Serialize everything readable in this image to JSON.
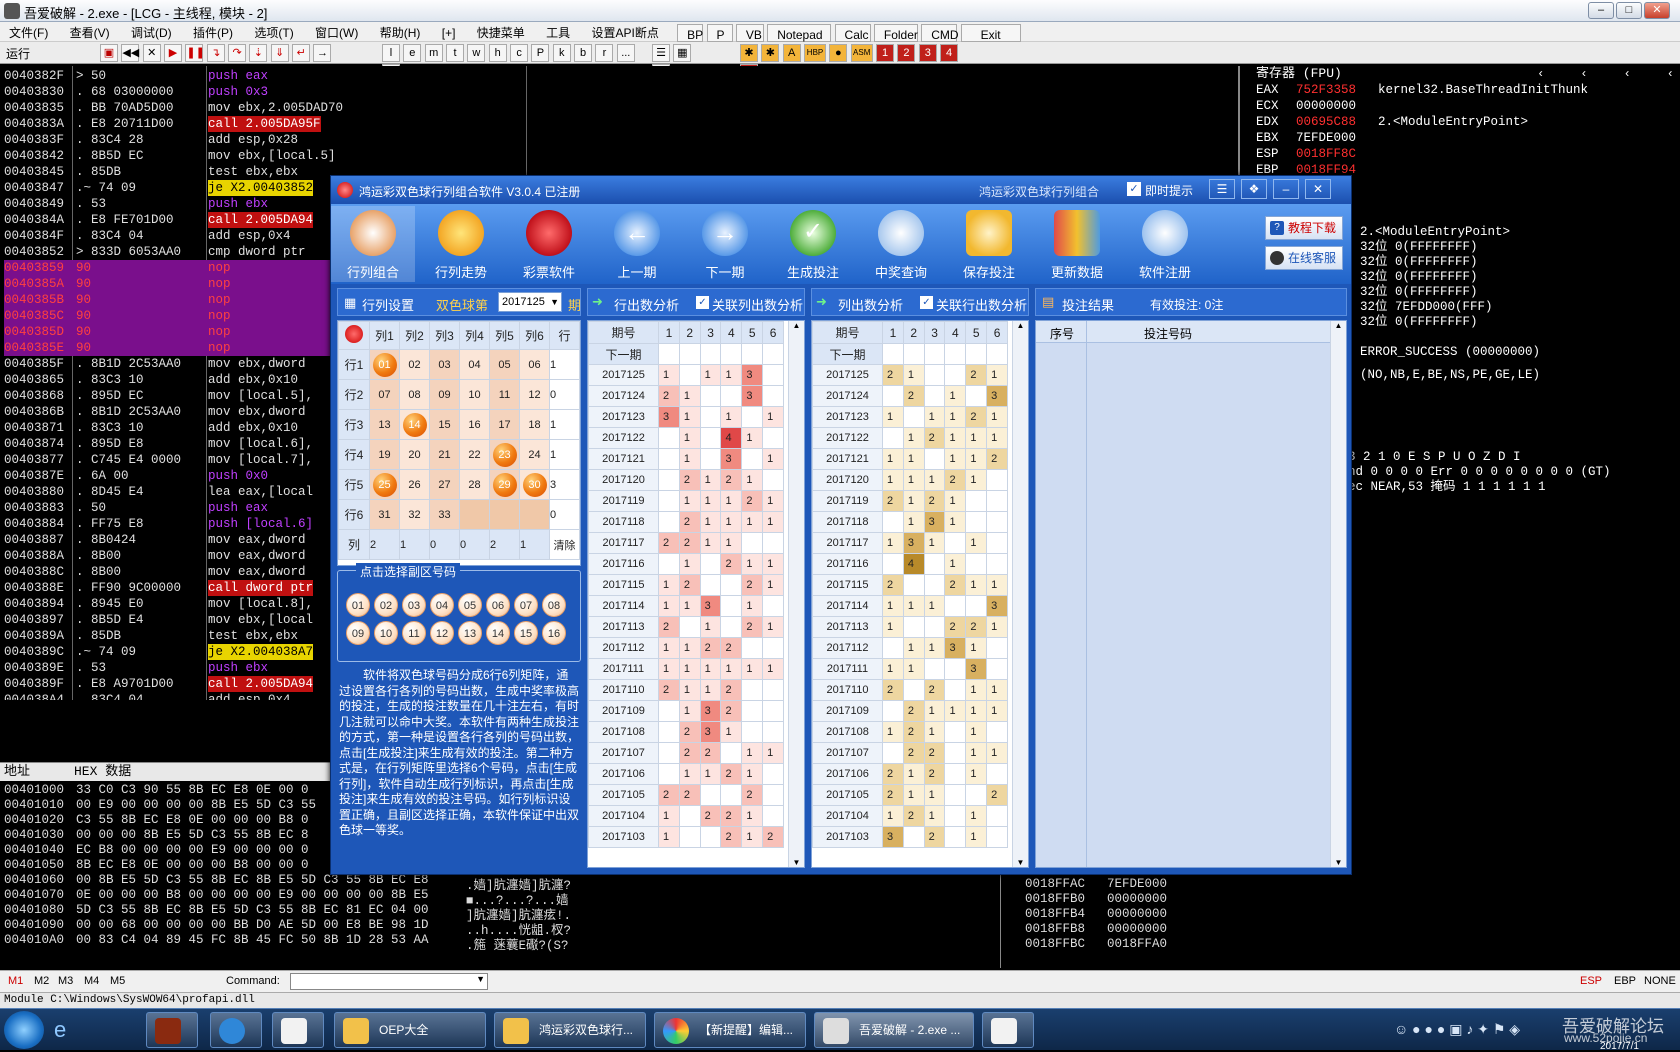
{
  "window": {
    "title": "吾爱破解 - 2.exe - [LCG - 主线程, 模块 - 2]",
    "status_run": "运行"
  },
  "menu": [
    "文件(F)",
    "查看(V)",
    "调试(D)",
    "插件(P)",
    "选项(T)",
    "窗口(W)",
    "帮助(H)",
    "[+]",
    "快捷菜单",
    "工具",
    "设置API断点"
  ],
  "quick_buttons": [
    "BP",
    "P",
    "VB",
    "Notepad",
    "Calc",
    "Folder",
    "CMD",
    "Exit"
  ],
  "toolbar_letters": [
    "l",
    "e",
    "m",
    "t",
    "w",
    "h",
    "c",
    "P",
    "k",
    "b",
    "r",
    "...",
    "s"
  ],
  "toolbar_nums": [
    "1",
    "2",
    "3",
    "4",
    "5"
  ],
  "disasm": [
    [
      "0040382F",
      ">  50",
      "push eax"
    ],
    [
      "00403830",
      ".  68 03000000",
      "push 0x3"
    ],
    [
      "00403835",
      ".  BB 70AD5D00",
      "mov ebx,2.005DAD70"
    ],
    [
      "0040383A",
      ".  E8 20711D00",
      "call 2.005DA95F"
    ],
    [
      "0040383F",
      ".  83C4 28",
      "add esp,0x28"
    ],
    [
      "00403842",
      ".  8B5D EC",
      "mov ebx,[local.5]"
    ],
    [
      "00403845",
      ".  85DB",
      "test ebx,ebx"
    ],
    [
      "00403847",
      ".~ 74 09",
      "je X2.00403852"
    ],
    [
      "00403849",
      ".  53",
      "push ebx"
    ],
    [
      "0040384A",
      ".  E8 FE701D00",
      "call 2.005DA94"
    ],
    [
      "0040384F",
      ".  83C4 04",
      "add esp,0x4"
    ],
    [
      "00403852",
      ">  833D 6053AA0",
      "cmp dword ptr"
    ],
    [
      "00403859",
      "   90",
      "nop"
    ],
    [
      "0040385A",
      "   90",
      "nop"
    ],
    [
      "0040385B",
      "   90",
      "nop"
    ],
    [
      "0040385C",
      "   90",
      "nop"
    ],
    [
      "0040385D",
      "   90",
      "nop"
    ],
    [
      "0040385E",
      "   90",
      "nop"
    ],
    [
      "0040385F",
      ".  8B1D 2C53AA0",
      "mov ebx,dword"
    ],
    [
      "00403865",
      ".  83C3 10",
      "add ebx,0x10"
    ],
    [
      "00403868",
      ".  895D EC",
      "mov [local.5],"
    ],
    [
      "0040386B",
      ".  8B1D 2C53AA0",
      "mov ebx,dword"
    ],
    [
      "00403871",
      ".  83C3 10",
      "add ebx,0x10"
    ],
    [
      "00403874",
      ".  895D E8",
      "mov [local.6],"
    ],
    [
      "00403877",
      ".  C745 E4 0000",
      "mov [local.7],"
    ],
    [
      "0040387E",
      ".  6A 00",
      "push 0x0"
    ],
    [
      "00403880",
      ".  8D45 E4",
      "lea eax,[local"
    ],
    [
      "00403883",
      ".  50",
      "push eax"
    ],
    [
      "00403884",
      ".  FF75 E8",
      "push [local.6]"
    ],
    [
      "00403887",
      ".  8B0424",
      "mov eax,dword"
    ],
    [
      "0040388A",
      ".  8B00",
      "mov eax,dword"
    ],
    [
      "0040388C",
      ".  8B00",
      "mov eax,dword"
    ],
    [
      "0040388E",
      ".  FF90 9C00000",
      "call dword ptr"
    ],
    [
      "00403894",
      ".  8945 E0",
      "mov [local.8],"
    ],
    [
      "00403897",
      ".  8B5D E4",
      "mov ebx,[local"
    ],
    [
      "0040389A",
      ".  85DB",
      "test ebx,ebx"
    ],
    [
      "0040389C",
      ".~ 74 09",
      "je X2.004038A7"
    ],
    [
      "0040389E",
      ".  53",
      "push ebx"
    ],
    [
      "0040389F",
      ".  E8 A9701D00",
      "call 2.005DA94"
    ],
    [
      "004038A4",
      ".  83C4 04",
      "add esp,0x4"
    ]
  ],
  "registers_title": "寄存器 (FPU)",
  "registers": [
    [
      "EAX",
      "752F3358",
      "kernel32.BaseThreadInitThunk"
    ],
    [
      "ECX",
      "00000000",
      ""
    ],
    [
      "EDX",
      "00695C88",
      "2.<ModuleEntryPoint>"
    ],
    [
      "EBX",
      "7EFDE000",
      ""
    ],
    [
      "ESP",
      "0018FF8C",
      ""
    ],
    [
      "EBP",
      "0018FF94",
      ""
    ]
  ],
  "reg_extra": [
    "2.<ModuleEntryPoint>",
    "32位 0(FFFFFFFF)",
    "32位 0(FFFFFFFF)",
    "32位 0(FFFFFFFF)",
    "32位 0(FFFFFFFF)",
    "32位 7EFDD000(FFF)",
    "32位 0(FFFFFFFF)",
    "ERROR_SUCCESS (00000000)",
    "(NO,NB,E,BE,NS,PE,GE,LE)",
    "3 2 1 0      E S P U O Z D I",
    "nd 0 0 0 0  Err 0 0 0 0 0 0 0 0  (GT)",
    "ec NEAR,53  掩码    1 1 1 1 1 1"
  ],
  "dump_header": [
    "地址",
    "HEX 数据"
  ],
  "dump": [
    [
      "00401000",
      "33 C0 C3 90 55 8B EC E8 0E 00 0"
    ],
    [
      "00401010",
      "00 E9 00 00 00 00 8B E5 5D C3 55"
    ],
    [
      "00401020",
      "C3 55 8B EC E8 0E 00 00 00 B8 0"
    ],
    [
      "00401030",
      "00 00 00 8B E5 5D C3 55 8B EC 8"
    ],
    [
      "00401040",
      "EC B8 00 00 00 00 E9 00 00 00 0"
    ],
    [
      "00401050",
      "8B EC E8 0E 00 00 00 B8 00 00 0"
    ],
    [
      "00401060",
      "00 8B E5 5D C3 55 8B EC 8B E5 5D C3 55 8B EC E8"
    ],
    [
      "00401070",
      "0E 00 00 00 B8 00 00 00 00 E9 00 00 00 00 8B E5"
    ],
    [
      "00401080",
      "5D C3 55 8B EC 8B E5 5D C3 55 8B EC 81 EC 04 00"
    ],
    [
      "00401090",
      "00 00 68 00 00 00 00 BB D0 AE 5D 00 E8 BE 98 1D"
    ],
    [
      "004010A0",
      "00 83 C4 04 89 45 FC 8B 45 FC 50 8B 1D 28 53 AA"
    ]
  ],
  "dump_ascii": [
    ".嫱]肮瀍嫱]肮瀍?",
    "■...?...?...嫱",
    "]肮瀍嫱]肮瀍痃!.",
    "..h....恍龃.杈?",
    ".箷 蒾蘘E礟?(S?"
  ],
  "stack": [
    [
      "0018FFA8",
      "00000000"
    ],
    [
      "0018FFAC",
      "7EFDE000"
    ],
    [
      "0018FFB0",
      "00000000"
    ],
    [
      "0018FFB4",
      "00000000"
    ],
    [
      "0018FFB8",
      "00000000"
    ],
    [
      "0018FFBC",
      "0018FFA0"
    ]
  ],
  "bottom": {
    "tabs": [
      "M1",
      "M2",
      "M3",
      "M4",
      "M5"
    ],
    "command_label": "Command:",
    "flags": [
      "ESP",
      "EBP",
      "NONE"
    ],
    "module": "Module C:\\Windows\\SysWOW64\\profapi.dll"
  },
  "app": {
    "title": "鸿运彩双色球行列组合软件 V3.0.4  已注册",
    "subtitle": "鸿运彩双色球行列组合",
    "instant_hint": "即时提示",
    "tools": [
      "行列组合",
      "行列走势",
      "彩票软件",
      "上一期",
      "下一期",
      "生成投注",
      "中奖查询",
      "保存投注",
      "更新数据",
      "软件注册"
    ],
    "btn_tutorial": "教程下载",
    "btn_service": "在线客服",
    "sec_rowcol": "行列设置",
    "lottery": "双色球第",
    "period_sel": "2017125",
    "period_unit": "期",
    "sec_row_analysis": "行出数分析",
    "chk_col": "关联列出数分析",
    "sec_col_analysis": "列出数分析",
    "chk_row": "关联行出数分析",
    "sec_result": "投注结果",
    "valid_bet": "有效投注: 0注",
    "matrix_headers": [
      "列1",
      "列2",
      "列3",
      "列4",
      "列5",
      "列6",
      "行"
    ],
    "matrix_rows": [
      {
        "label": "行1",
        "cells": [
          "01",
          "02",
          "03",
          "04",
          "05",
          "06"
        ],
        "sel": [
          0
        ],
        "count": "1"
      },
      {
        "label": "行2",
        "cells": [
          "07",
          "08",
          "09",
          "10",
          "11",
          "12"
        ],
        "sel": [],
        "count": "0"
      },
      {
        "label": "行3",
        "cells": [
          "13",
          "14",
          "15",
          "16",
          "17",
          "18"
        ],
        "sel": [
          1
        ],
        "count": "1"
      },
      {
        "label": "行4",
        "cells": [
          "19",
          "20",
          "21",
          "22",
          "23",
          "24"
        ],
        "sel": [
          4
        ],
        "count": "1"
      },
      {
        "label": "行5",
        "cells": [
          "25",
          "26",
          "27",
          "28",
          "29",
          "30"
        ],
        "sel": [
          0,
          4,
          5
        ],
        "count": "3"
      },
      {
        "label": "行6",
        "cells": [
          "31",
          "32",
          "33",
          "",
          "",
          ""
        ],
        "sel": [],
        "count": "0"
      }
    ],
    "matrix_footer": {
      "label": "列",
      "counts": [
        "2",
        "1",
        "0",
        "0",
        "2",
        "1"
      ],
      "clear": "清除"
    },
    "sub_title": "点击选择副区号码",
    "sub_balls": [
      "01",
      "02",
      "03",
      "04",
      "05",
      "06",
      "07",
      "08",
      "09",
      "10",
      "11",
      "12",
      "13",
      "14",
      "15",
      "16"
    ],
    "description": "软件将双色球号码分成6行6列矩阵，通过设置各行各列的号码出数，生成中奖率极高的投注，生成的投注数量在几十注左右，有时几注就可以命中大奖。本软件有两种生成投注的方式，第一种是设置各行各列的号码出数，点击[生成投注]来生成有效的投注。第二种方式是，在行列矩阵里选择6个号码，点击[生成行列]，软件自动生成行列标识，再点击[生成投注]来生成有效的投注号码。如行列标识设置正确，且副区选择正确，本软件保证中出双色球一等奖。",
    "ana_head": [
      "期号",
      "1",
      "2",
      "3",
      "4",
      "5",
      "6"
    ],
    "ana_next": "下一期",
    "periods": [
      "2017125",
      "2017124",
      "2017123",
      "2017122",
      "2017121",
      "2017120",
      "2017119",
      "2017118",
      "2017117",
      "2017116",
      "2017115",
      "2017114",
      "2017113",
      "2017112",
      "2017111",
      "2017110",
      "2017109",
      "2017108",
      "2017107",
      "2017106",
      "2017105",
      "2017104",
      "2017103"
    ],
    "row_vals": [
      [
        "1",
        "",
        "1",
        "1",
        "3",
        ""
      ],
      [
        "2",
        "1",
        "",
        "",
        "3",
        ""
      ],
      [
        "3",
        "1",
        "",
        "1",
        "",
        "1"
      ],
      [
        "",
        "1",
        "",
        "4",
        "1",
        ""
      ],
      [
        "",
        "1",
        "",
        "3",
        "",
        "1"
      ],
      [
        "",
        "2",
        "1",
        "2",
        "1",
        ""
      ],
      [
        "",
        "1",
        "1",
        "1",
        "2",
        "1"
      ],
      [
        "",
        "2",
        "1",
        "1",
        "1",
        "1"
      ],
      [
        "2",
        "2",
        "1",
        "1",
        "",
        ""
      ],
      [
        "",
        "1",
        "",
        "2",
        "1",
        "1"
      ],
      [
        "1",
        "2",
        "",
        "",
        "2",
        "1"
      ],
      [
        "1",
        "1",
        "3",
        "",
        "1",
        ""
      ],
      [
        "2",
        "",
        "1",
        "",
        "2",
        "1"
      ],
      [
        "1",
        "1",
        "2",
        "2",
        "",
        ""
      ],
      [
        "1",
        "1",
        "1",
        "1",
        "1",
        "1"
      ],
      [
        "2",
        "1",
        "1",
        "2",
        "",
        ""
      ],
      [
        "",
        "1",
        "3",
        "2",
        "",
        ""
      ],
      [
        "",
        "2",
        "3",
        "1",
        "",
        ""
      ],
      [
        "",
        "2",
        "2",
        "",
        "1",
        "1"
      ],
      [
        "",
        "1",
        "1",
        "2",
        "1",
        ""
      ],
      [
        "2",
        "2",
        "",
        "",
        "2",
        ""
      ],
      [
        "1",
        "",
        "2",
        "2",
        "1",
        ""
      ],
      [
        "1",
        "",
        "",
        "2",
        "1",
        "2"
      ]
    ],
    "col_vals": [
      [
        "2",
        "1",
        "",
        "",
        "2",
        "1"
      ],
      [
        "",
        "2",
        "",
        "1",
        "",
        "3"
      ],
      [
        "1",
        "",
        "1",
        "1",
        "2",
        "1"
      ],
      [
        "",
        "1",
        "2",
        "1",
        "1",
        "1"
      ],
      [
        "1",
        "1",
        "",
        "1",
        "1",
        "2"
      ],
      [
        "1",
        "1",
        "1",
        "2",
        "1",
        ""
      ],
      [
        "2",
        "1",
        "2",
        "1",
        "",
        ""
      ],
      [
        "",
        "1",
        "3",
        "1",
        "",
        ""
      ],
      [
        "1",
        "3",
        "1",
        "",
        "1",
        ""
      ],
      [
        "",
        "4",
        "",
        "1",
        "",
        ""
      ],
      [
        "2",
        "",
        "",
        "2",
        "1",
        "1"
      ],
      [
        "1",
        "1",
        "1",
        "",
        "",
        "3"
      ],
      [
        "1",
        "",
        "",
        "2",
        "2",
        "1"
      ],
      [
        "",
        "1",
        "1",
        "3",
        "1",
        ""
      ],
      [
        "1",
        "1",
        "",
        "",
        "3",
        ""
      ],
      [
        "2",
        "",
        "2",
        "",
        "1",
        "1"
      ],
      [
        "",
        "2",
        "1",
        "1",
        "1",
        "1"
      ],
      [
        "1",
        "2",
        "1",
        "",
        "1",
        ""
      ],
      [
        "",
        "2",
        "2",
        "",
        "1",
        "1"
      ],
      [
        "2",
        "1",
        "2",
        "",
        "1",
        ""
      ],
      [
        "2",
        "1",
        "1",
        "",
        "",
        "2"
      ],
      [
        "1",
        "2",
        "1",
        "",
        "1",
        ""
      ],
      [
        "3",
        "",
        "2",
        "",
        "1",
        ""
      ]
    ],
    "result_head": [
      "序号",
      "投注号码"
    ]
  },
  "taskbar": {
    "tasks": [
      "",
      "",
      "",
      "OEP大全",
      "鸿运彩双色球行...",
      "【新提醒】编辑...",
      "吾爱破解 - 2.exe ..."
    ],
    "watermark": "吾爱破解论坛",
    "watermark_url": "www.52pojie.cn",
    "date": "2017/7/1"
  },
  "colors": {
    "accent": "#1e57b8",
    "selected_ball": "#f07a10",
    "highlight_row": "#7a0f8c",
    "register_changed": "#ff3030",
    "keyword": "#c040ff"
  }
}
